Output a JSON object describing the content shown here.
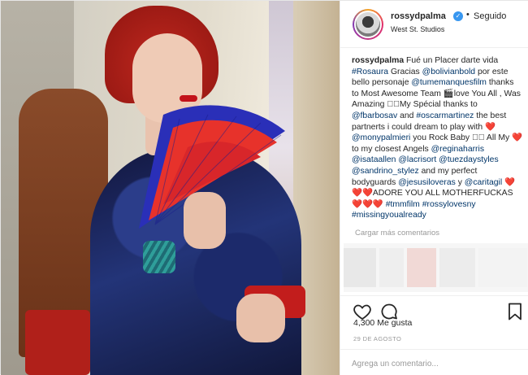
{
  "post": {
    "username": "rossydpalma",
    "separator": "•",
    "follow_state": "Seguido",
    "location": "West St. Studios",
    "caption": {
      "username": "rossydpalma",
      "text_parts": [
        {
          "t": "Fué un Placer darte vida "
        },
        {
          "t": "#Rosaura",
          "link": true
        },
        {
          "t": " Gracias "
        },
        {
          "t": "@bolivianbold",
          "link": true
        },
        {
          "t": " por este bello personaje "
        },
        {
          "t": "@tumemanquesfilm",
          "link": true
        },
        {
          "t": " thanks to Most Awesome Team 🎬love You All , Was Amazing 🏻🏻My Spécial thanks to "
        },
        {
          "t": "@fbarbosav",
          "link": true
        },
        {
          "t": " and "
        },
        {
          "t": "#oscarmartinez",
          "link": true
        },
        {
          "t": " the best partnerts i could dream to play with "
        },
        {
          "t": "❤️@monypalmieri",
          "link": true
        },
        {
          "t": " you Rock Baby 🏻🏻 All My ❤️to my closest Angels "
        },
        {
          "t": "@reginaharris",
          "link": true
        },
        {
          "t": " "
        },
        {
          "t": "@isataallen",
          "link": true
        },
        {
          "t": " "
        },
        {
          "t": "@lacrisort",
          "link": true
        },
        {
          "t": " "
        },
        {
          "t": "@tuezdaystyles",
          "link": true
        },
        {
          "t": " "
        },
        {
          "t": "@sandrino_stylez",
          "link": true
        },
        {
          "t": " and my perfect bodyguards "
        },
        {
          "t": "@jesusiloveras",
          "link": true
        },
        {
          "t": " y "
        },
        {
          "t": "@caritagil",
          "link": true
        },
        {
          "t": " ❤️❤️❤️ADORE YOU ALL MOTHERFUCKAS❤️❤️❤️ "
        },
        {
          "t": "#tmmfilm",
          "link": true
        },
        {
          "t": " "
        },
        {
          "t": "#rossylovesny",
          "link": true
        },
        {
          "t": " "
        },
        {
          "t": "#missingyoualready",
          "link": true
        }
      ]
    },
    "load_more_comments": "Cargar más comentarios",
    "likes": "4,300 Me gusta",
    "date": "29 DE AGOSTO",
    "comment_placeholder": "Agrega un comentario...",
    "icons": {
      "heart": "heart-icon",
      "comment": "comment-icon",
      "bookmark": "bookmark-icon",
      "verified": "verified-badge-icon"
    },
    "colors": {
      "link": "#003569",
      "verified": "#3897f0",
      "muted": "#999999"
    }
  }
}
